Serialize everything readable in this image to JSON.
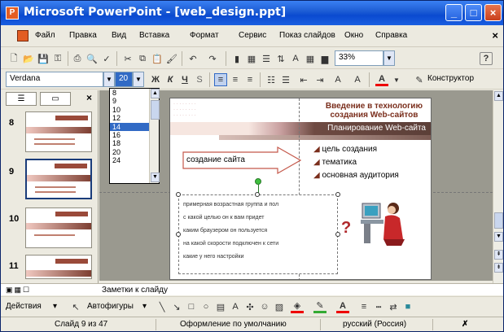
{
  "window": {
    "title": "Microsoft PowerPoint - [web_design.ppt]",
    "controls": {
      "minimize": "_",
      "maximize": "□",
      "close": "×"
    }
  },
  "menu": {
    "items": [
      "Файл",
      "Правка",
      "Вид",
      "Вставка",
      "Формат",
      "Сервис",
      "Показ слайдов",
      "Окно",
      "Справка"
    ],
    "close": "×"
  },
  "toolbar_standard": {
    "zoom": "33%",
    "help": "?"
  },
  "toolbar_format": {
    "font": "Verdana",
    "size": "20",
    "bold": "Ж",
    "italic": "К",
    "underline": "Ч",
    "shadow": "S",
    "font_color": "A",
    "designer_label": "Конструктор"
  },
  "size_list": {
    "options": [
      "8",
      "9",
      "10",
      "12",
      "14",
      "16",
      "18",
      "20",
      "24"
    ],
    "selected": "14"
  },
  "left_panel": {
    "slide_numbers": [
      "8",
      "9",
      "10",
      "11"
    ],
    "close": "×"
  },
  "slide": {
    "title_line1": "Введение в технологию",
    "title_line2": "создания Web-сайтов",
    "subtitle": "Планирование Web-сайта",
    "arrow_text": "создание сайта",
    "bullets": [
      "цель создания",
      "тематика",
      "основная аудитория"
    ],
    "box_items": [
      "примерная возрастная группа и пол",
      "с какой целью он к вам придет",
      "каким браузером он пользуется",
      "на какой скорости подключен к сети",
      "какие у него настройки"
    ],
    "question_mark": "?"
  },
  "notes": {
    "label": "Заметки к слайду"
  },
  "draw_toolbar": {
    "actions": "Действия",
    "autoshapes": "Автофигуры"
  },
  "status": {
    "slide": "Слайд 9 из 47",
    "design": "Оформление по умолчанию",
    "language": "русский (Россия)"
  },
  "colors": {
    "titlebar": "#0a4ad0",
    "slide_accent": "#7a2e1c",
    "selection": "#316ac5"
  }
}
